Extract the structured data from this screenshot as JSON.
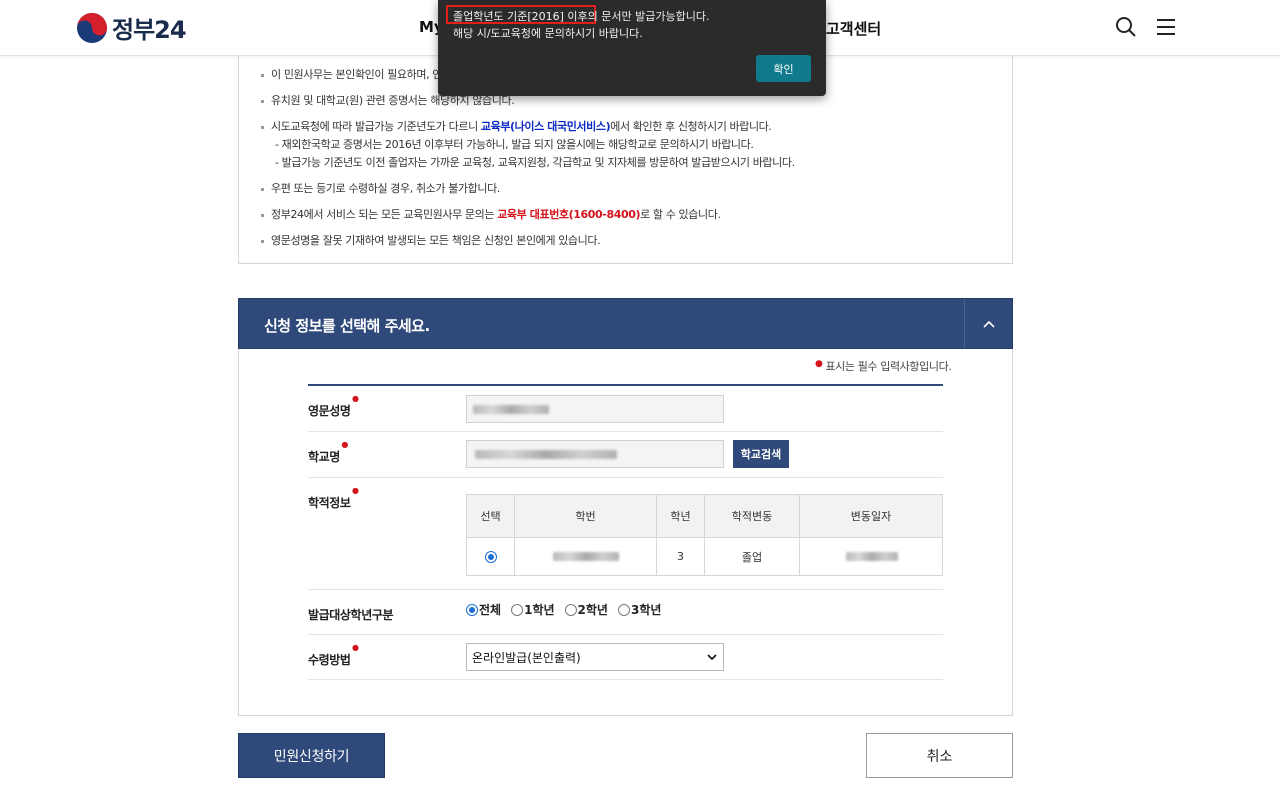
{
  "header": {
    "logo_text": "정부24",
    "nav_my": "My",
    "nav_customer_center": "고객센터"
  },
  "dialog": {
    "message_line1": "졸업학년도 기준[2016] 이후의 문서만 발급가능합니다.",
    "message_line2": "해당 시/도교육청에 문의하시기 바랍니다.",
    "ok_label": "확인"
  },
  "notice": {
    "item1": "이 민원사무는 본인확인이 필요하며, 인",
    "item2": "유치원 및 대학교(원) 관련 증명서는 해당하지 않습니다.",
    "item3_pre": "시도교육청에 따라 발급가능 기준년도가 다르니 ",
    "item3_link": "교육부(나이스 대국민서비스)",
    "item3_post": "에서 확인한 후 신청하시기 바랍니다.",
    "item3_sub1": "- 재외한국학교 증명서는 2016년 이후부터 가능하니, 발급 되지 않을시에는 해당학교로 문의하시기 바랍니다.",
    "item3_sub2": "- 발급가능 기준년도 이전 졸업자는 가까운 교육청, 교육지원청, 각급학교 및 지자체를 방문하여 발급받으시기 바랍니다.",
    "item4": "우편 또는 등기로 수령하실 경우, 취소가 불가합니다.",
    "item5_pre": "정부24에서 서비스 되는 모든 교육민원사무 문의는 ",
    "item5_highlight": "교육부 대표번호(1600-8400)",
    "item5_post": "로 할 수 있습니다.",
    "item6": "영문성명을 잘못 기재하여 발생되는 모든 책임은 신청인 본인에게 있습니다."
  },
  "section": {
    "title": "신청 정보를 선택해 주세요.",
    "required_note": "표시는 필수 입력사항입니다."
  },
  "form": {
    "english_name_label": "영문성명",
    "school_name_label": "학교명",
    "school_search_button": "학교검색",
    "academic_info_label": "학적정보",
    "table_headers": [
      "선택",
      "학번",
      "학년",
      "학적변동",
      "변동일자"
    ],
    "table_row": {
      "grade": "3",
      "status": "졸업"
    },
    "grade_target_label": "발급대상학년구분",
    "grade_options": [
      "전체",
      "1학년",
      "2학년",
      "3학년"
    ],
    "grade_selected": "전체",
    "receive_method_label": "수령방법",
    "receive_method_value": "온라인발급(본인출력)"
  },
  "actions": {
    "apply_label": "민원신청하기",
    "cancel_label": "취소"
  }
}
